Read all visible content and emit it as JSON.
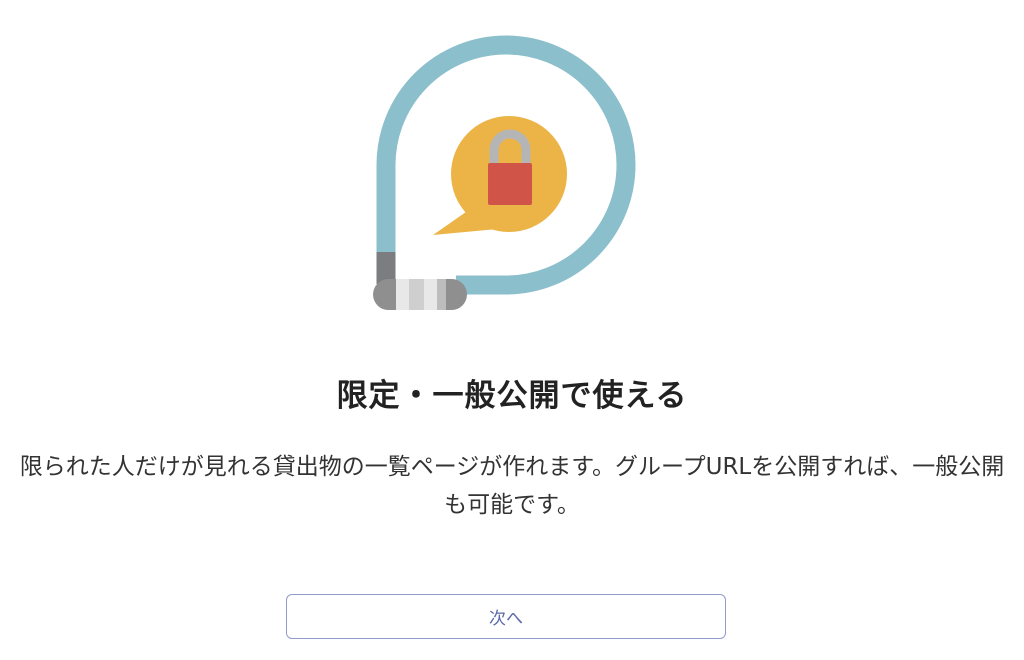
{
  "illustration": {
    "icon": "bike-lock-speech-bubble-icon",
    "colors": {
      "cable": "#8bbfcc",
      "bubble": "#ecb447",
      "padlock_body": "#d05548",
      "shackle": "#b5b5b5"
    }
  },
  "content": {
    "title": "限定・一般公開で使える",
    "description": "限られた人だけが見れる貸出物の一覧ページが作れます。グループURLを公開すれば、一般公開も可能です。"
  },
  "actions": {
    "next_label": "次へ"
  },
  "colors": {
    "button_border": "#8f9bc9",
    "button_text": "#5b6aa8"
  }
}
